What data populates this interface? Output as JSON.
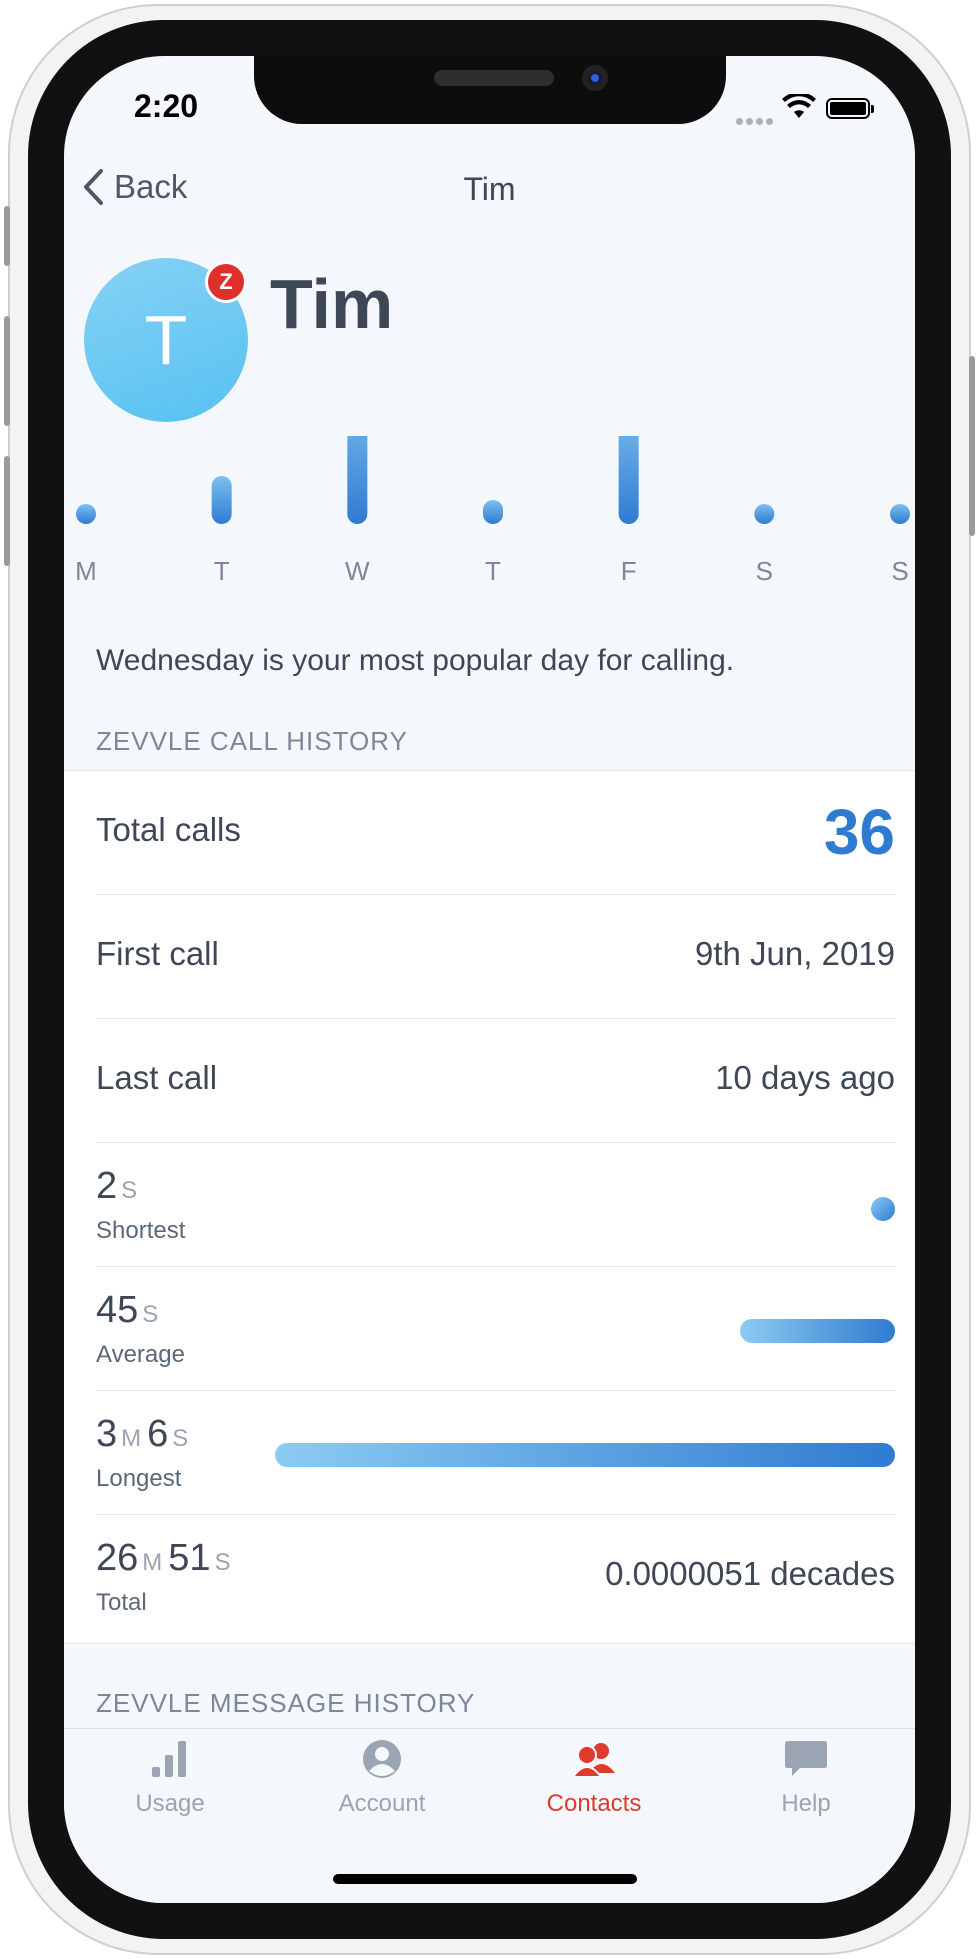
{
  "status_bar": {
    "time": "2:20"
  },
  "nav": {
    "back_label": "Back",
    "title": "Tim"
  },
  "contact": {
    "initial": "T",
    "name": "Tim",
    "badge_letter": "Z"
  },
  "chart_data": {
    "type": "bar",
    "categories": [
      "M",
      "T",
      "W",
      "T",
      "F",
      "S",
      "S"
    ],
    "values": [
      0,
      4,
      11,
      2,
      10,
      0,
      0
    ],
    "title": "",
    "xlabel": "",
    "ylabel": ""
  },
  "chart_caption": "Wednesday is your most popular day for calling.",
  "call_history": {
    "heading": "ZEVVLE CALL HISTORY",
    "total_calls_label": "Total calls",
    "total_calls_value": "36",
    "first_call_label": "First call",
    "first_call_value": "9th Jun, 2019",
    "last_call_label": "Last call",
    "last_call_value": "10 days ago",
    "shortest": {
      "seconds": "2",
      "s_unit": "S",
      "label": "Shortest",
      "fraction": 0.011
    },
    "average": {
      "seconds": "45",
      "s_unit": "S",
      "label": "Average",
      "fraction": 0.25
    },
    "longest": {
      "minutes": "3",
      "m_unit": "M",
      "seconds": "6",
      "s_unit": "S",
      "label": "Longest",
      "fraction": 1.0
    },
    "total": {
      "minutes": "26",
      "m_unit": "M",
      "seconds": "51",
      "s_unit": "S",
      "label": "Total",
      "decades": "0.0000051 decades"
    }
  },
  "message_history": {
    "heading": "ZEVVLE MESSAGE HISTORY"
  },
  "tabs": [
    {
      "label": "Usage",
      "icon": "bar-chart-icon",
      "active": false
    },
    {
      "label": "Account",
      "icon": "person-circle-icon",
      "active": false
    },
    {
      "label": "Contacts",
      "icon": "contacts-icon",
      "active": true
    },
    {
      "label": "Help",
      "icon": "chat-bubble-icon",
      "active": false
    }
  ],
  "colors": {
    "accent": "#2f7bd0",
    "active_tab": "#de3a2e",
    "avatar": "#6ccaf3"
  }
}
